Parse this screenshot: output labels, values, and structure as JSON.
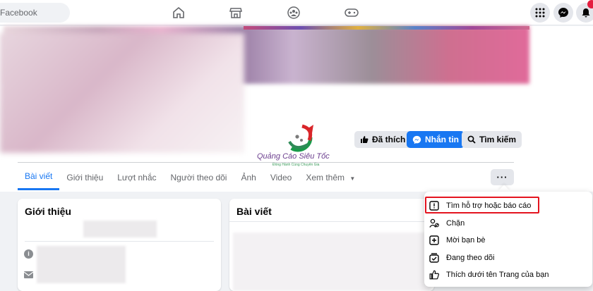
{
  "search": {
    "placeholder": "Facebook"
  },
  "nav": [
    "home-icon",
    "marketplace-icon",
    "groups-icon",
    "gaming-icon"
  ],
  "header_right": [
    "menu-grid-icon",
    "messenger-icon",
    "notifications-icon"
  ],
  "logo": {
    "name": "Quảng Cáo Siêu Tốc",
    "tagline": "Đồng Hành Cùng Chuyên Gia"
  },
  "actions": {
    "liked": "Đã thích",
    "message": "Nhắn tin",
    "search": "Tìm kiếm"
  },
  "tabs": [
    "Bài viết",
    "Giới thiệu",
    "Lượt nhắc",
    "Người theo dõi",
    "Ảnh",
    "Video",
    "Xem thêm"
  ],
  "more_button": "···",
  "intro": {
    "title": "Giới thiệu"
  },
  "posts": {
    "title": "Bài viết"
  },
  "menu": {
    "items": [
      {
        "label": "Tìm hỗ trợ hoặc báo cáo",
        "icon": "report-icon"
      },
      {
        "label": "Chặn",
        "icon": "block-user-icon"
      },
      {
        "label": "Mời bạn bè",
        "icon": "invite-icon"
      },
      {
        "label": "Đang theo dõi",
        "icon": "following-icon"
      },
      {
        "label": "Thích dưới tên Trang của bạn",
        "icon": "like-as-page-icon"
      }
    ]
  },
  "colors": {
    "accent": "#1877f2",
    "highlight": "#e4141f"
  }
}
